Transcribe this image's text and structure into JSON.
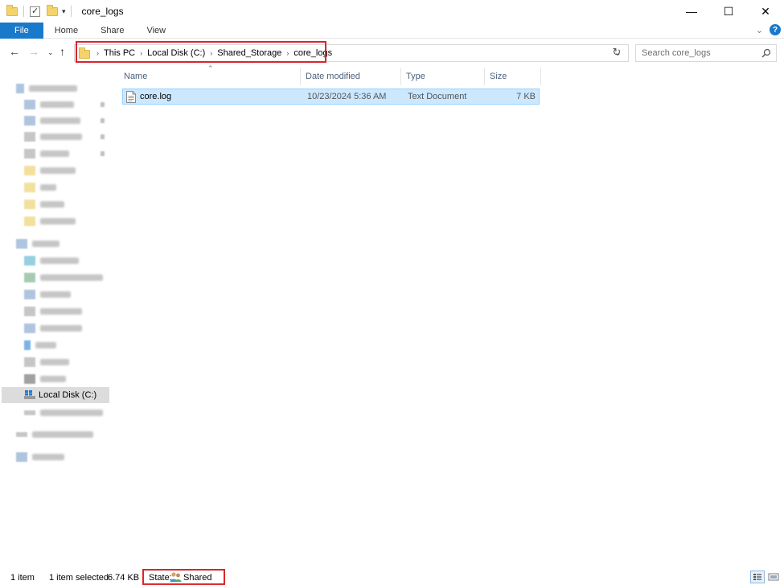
{
  "window": {
    "title": "core_logs"
  },
  "ribbon": {
    "tabs": [
      "File",
      "Home",
      "Share",
      "View"
    ]
  },
  "address": {
    "breadcrumbs": [
      "This PC",
      "Local Disk (C:)",
      "Shared_Storage",
      "core_logs"
    ]
  },
  "search": {
    "placeholder": "Search core_logs"
  },
  "navpane": {
    "selected_label": "Local Disk (C:)"
  },
  "filelist": {
    "columns": [
      "Name",
      "Date modified",
      "Type",
      "Size"
    ],
    "rows": [
      {
        "name": "core.log",
        "date_modified": "10/23/2024 5:36 AM",
        "type": "Text Document",
        "size": "7 KB"
      }
    ]
  },
  "status": {
    "item_count": "1 item",
    "selection": "1 item selected",
    "selection_size": "6.74 KB",
    "state_label": "State:",
    "state_value": "Shared"
  },
  "colors": {
    "accent": "#1979ca",
    "selection": "#cce8ff",
    "highlight_box": "#d9262b"
  }
}
